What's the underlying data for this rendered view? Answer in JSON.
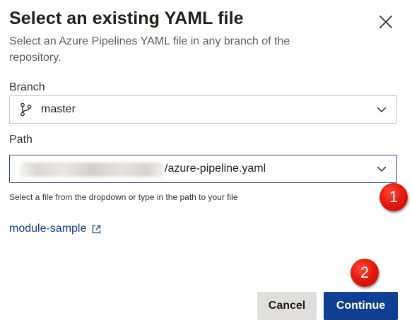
{
  "dialog": {
    "title": "Select an existing YAML file",
    "subtitle": "Select an Azure Pipelines YAML file in any branch of the repository.",
    "close_icon": "close-icon"
  },
  "branch": {
    "label": "Branch",
    "value": "master",
    "icon": "git-branch-icon"
  },
  "path": {
    "label": "Path",
    "value_suffix": "/azure-pipeline.yaml",
    "hint": "Select a file from the dropdown or type in the path to your file"
  },
  "link": {
    "text": "module-sample",
    "icon": "external-link-icon"
  },
  "annotations": {
    "badge_1": "1",
    "badge_2": "2",
    "badge_color": "#e51b0f"
  },
  "buttons": {
    "cancel": "Cancel",
    "continue": "Continue",
    "primary_color": "#0f3f94"
  }
}
